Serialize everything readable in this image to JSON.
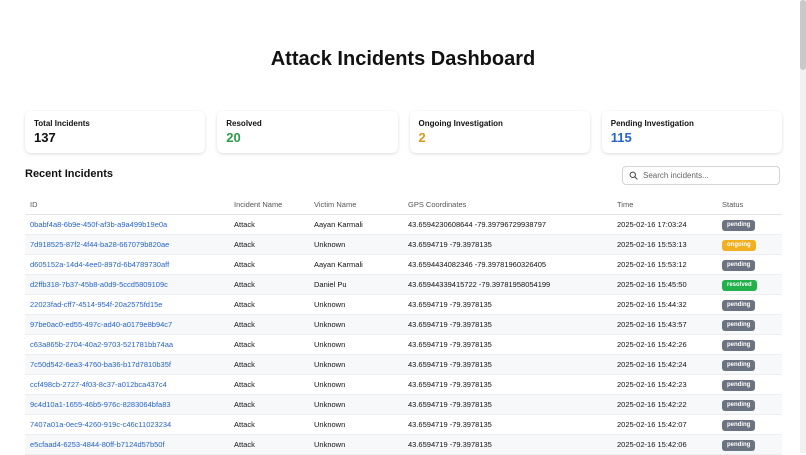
{
  "page": {
    "title": "Attack Incidents Dashboard"
  },
  "stats": [
    {
      "label": "Total Incidents",
      "value": "137",
      "color": "#111111"
    },
    {
      "label": "Resolved",
      "value": "20",
      "color": "#2a9d46"
    },
    {
      "label": "Ongoing Investigation",
      "value": "2",
      "color": "#d99a17"
    },
    {
      "label": "Pending Investigation",
      "value": "115",
      "color": "#2563c9"
    }
  ],
  "recent": {
    "title": "Recent Incidents",
    "search_placeholder": "Search incidents...",
    "columns": [
      "ID",
      "Incident Name",
      "Victim Name",
      "GPS Coordinates",
      "Time",
      "Status"
    ],
    "rows": [
      {
        "id": "0babf4a8-6b9e-450f-af3b-a9a499b19e0a",
        "name": "Attack",
        "victim": "Aayan Karmali",
        "gps": "43.6594230608644 -79.39796729938797",
        "time": "2025-02-16 17:03:24",
        "status": "pending"
      },
      {
        "id": "7d918525-87f2-4f44-ba28-667079b820ae",
        "name": "Attack",
        "victim": "Unknown",
        "gps": "43.6594719 -79.3978135",
        "time": "2025-02-16 15:53:13",
        "status": "ongoing"
      },
      {
        "id": "d605152a-14d4-4ee0-897d-6b4789730aff",
        "name": "Attack",
        "victim": "Aayan Karmali",
        "gps": "43.6594434082346 -79.39781960326405",
        "time": "2025-02-16 15:53:12",
        "status": "pending"
      },
      {
        "id": "d2ffb318-7b37-45b8-a0d9-5ccd5809109c",
        "name": "Attack",
        "victim": "Daniel Pu",
        "gps": "43.65944339415722 -79.39781958054199",
        "time": "2025-02-16 15:45:50",
        "status": "resolved"
      },
      {
        "id": "22023fad-cff7-4514-954f-20a2575fd15e",
        "name": "Attack",
        "victim": "Unknown",
        "gps": "43.6594719 -79.3978135",
        "time": "2025-02-16 15:44:32",
        "status": "pending"
      },
      {
        "id": "97be0ac0-ed55-497c-ad40-a0179e8b94c7",
        "name": "Attack",
        "victim": "Unknown",
        "gps": "43.6594719 -79.3978135",
        "time": "2025-02-16 15:43:57",
        "status": "pending"
      },
      {
        "id": "c63a865b-2704-40a2-9703-521781bb74aa",
        "name": "Attack",
        "victim": "Unknown",
        "gps": "43.6594719 -79.3978135",
        "time": "2025-02-16 15:42:26",
        "status": "pending"
      },
      {
        "id": "7c50d542-6ea3-4760-ba36-b17d7810b35f",
        "name": "Attack",
        "victim": "Unknown",
        "gps": "43.6594719 -79.3978135",
        "time": "2025-02-16 15:42:24",
        "status": "pending"
      },
      {
        "id": "ccf498cb-2727-4f03-8c37-a012bca437c4",
        "name": "Attack",
        "victim": "Unknown",
        "gps": "43.6594719 -79.3978135",
        "time": "2025-02-16 15:42:23",
        "status": "pending"
      },
      {
        "id": "9c4d10a1-1655-46b5-976c-8283064bfa83",
        "name": "Attack",
        "victim": "Unknown",
        "gps": "43.6594719 -79.3978135",
        "time": "2025-02-16 15:42:22",
        "status": "pending"
      },
      {
        "id": "7407a01a-0ec9-4260-919c-c46c11023234",
        "name": "Attack",
        "victim": "Unknown",
        "gps": "43.6594719 -79.3978135",
        "time": "2025-02-16 15:42:07",
        "status": "pending"
      },
      {
        "id": "e5cfaad4-6253-4844-80ff-b7124d57b50f",
        "name": "Attack",
        "victim": "Unknown",
        "gps": "43.6594719 -79.3978135",
        "time": "2025-02-16 15:42:06",
        "status": "pending"
      }
    ]
  },
  "icons": {
    "search": "search-icon"
  }
}
